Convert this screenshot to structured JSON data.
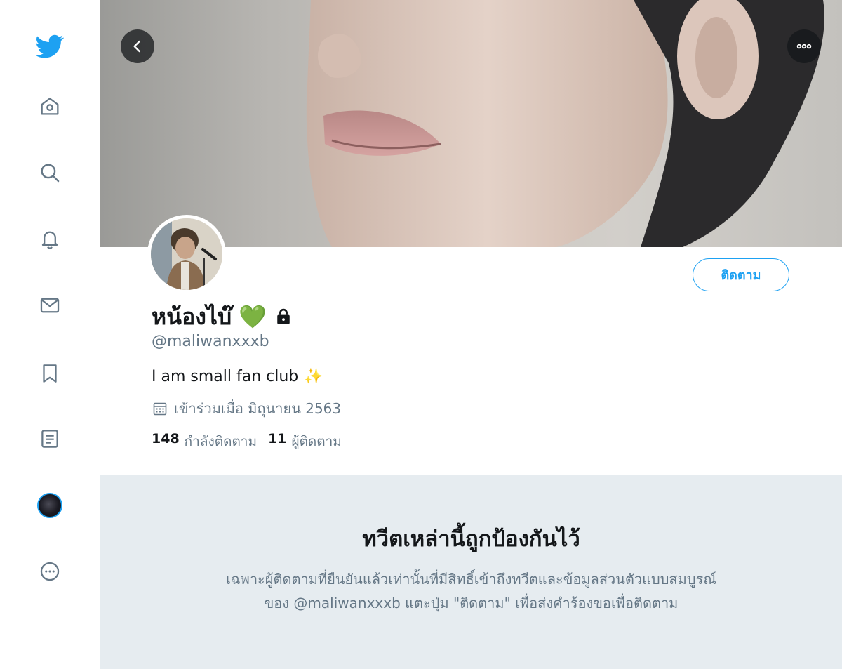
{
  "sidebar": {
    "items": [
      {
        "name": "twitter-logo-icon"
      },
      {
        "name": "home-icon"
      },
      {
        "name": "explore-search-icon"
      },
      {
        "name": "notifications-bell-icon"
      },
      {
        "name": "messages-envelope-icon"
      },
      {
        "name": "bookmarks-icon"
      },
      {
        "name": "lists-icon"
      },
      {
        "name": "profile-avatar-icon"
      },
      {
        "name": "more-options-icon"
      }
    ],
    "accent_color": "#1da1f2"
  },
  "header": {
    "back_icon": "chevron-left-icon",
    "more_icon": "more-horizontal-icon"
  },
  "profile": {
    "display_name": "หน้องไบ๊",
    "name_emoji": "💚",
    "protected_icon": "lock-icon",
    "handle": "@maliwanxxxb",
    "bio_text": "I am small fan club",
    "bio_emoji": "✨",
    "joined_icon": "calendar-icon",
    "joined": "เข้าร่วมเมื่อ มิถุนายน 2563",
    "following_count": "148",
    "following_label": "กำลังติดตาม",
    "followers_count": "11",
    "followers_label": "ผู้ติดตาม",
    "follow_button_label": "ติดตาม"
  },
  "protected_notice": {
    "title": "ทวีตเหล่านี้ถูกป้องกันไว้",
    "line1": "เฉพาะผู้ติดตามที่ยืนยันแล้วเท่านั้นที่มีสิทธิ์เข้าถึงทวีตและข้อมูลส่วนตัวแบบสมบูรณ์",
    "line2": "ของ @maliwanxxxb แตะปุ่ม \"ติดตาม\" เพื่อส่งคำร้องขอเพื่อติดตาม"
  },
  "colors": {
    "accent": "#1da1f2",
    "secondary_text": "#657786",
    "primary_text": "#14171a",
    "notice_background": "#e6ecf0"
  }
}
